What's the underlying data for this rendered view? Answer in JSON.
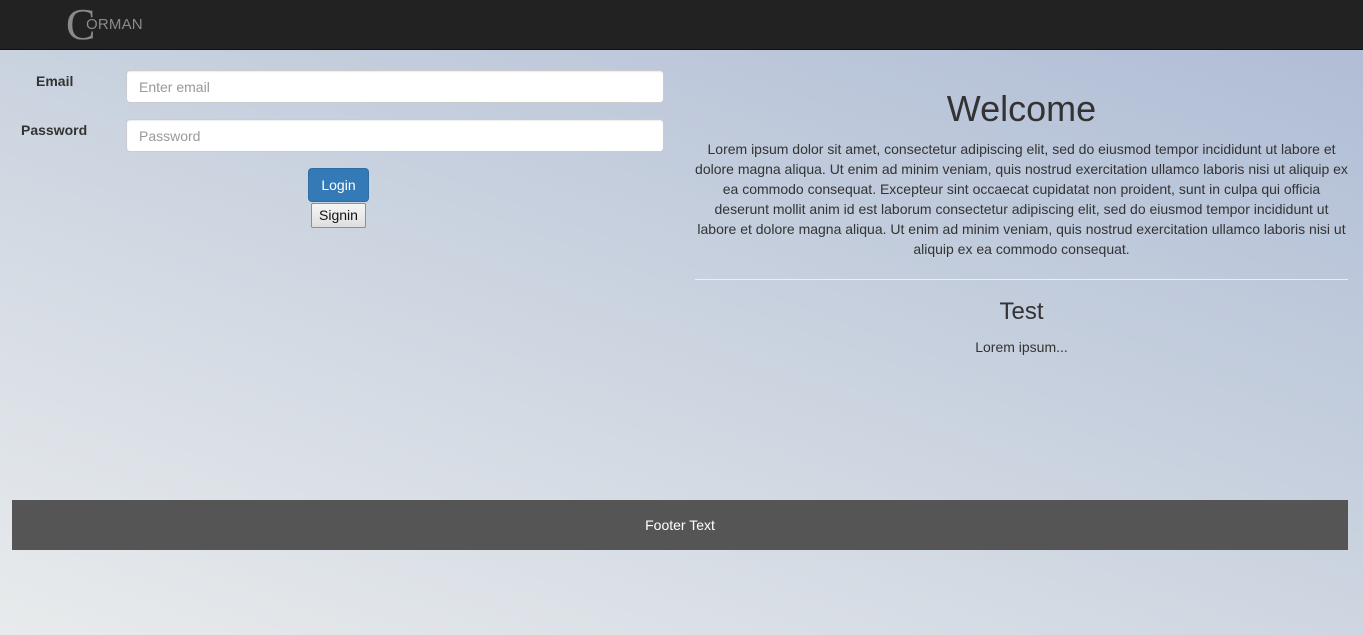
{
  "navbar": {
    "logo_initial": "C",
    "logo_rest": "ORMAN"
  },
  "login_form": {
    "email_label": "Email",
    "email_placeholder": "Enter email",
    "email_value": "",
    "password_label": "Password",
    "password_placeholder": "Password",
    "password_value": "",
    "login_button": "Login",
    "signin_button": "Signin"
  },
  "main": {
    "welcome_title": "Welcome",
    "welcome_text": "Lorem ipsum dolor sit amet, consectetur adipiscing elit, sed do eiusmod tempor incididunt ut labore et dolore magna aliqua. Ut enim ad minim veniam, quis nostrud exercitation ullamco laboris nisi ut aliquip ex ea commodo consequat. Excepteur sint occaecat cupidatat non proident, sunt in culpa qui officia deserunt mollit anim id est laborum consectetur adipiscing elit, sed do eiusmod tempor incididunt ut labore et dolore magna aliqua. Ut enim ad minim veniam, quis nostrud exercitation ullamco laboris nisi ut aliquip ex ea commodo consequat.",
    "test_title": "Test",
    "test_text": "Lorem ipsum..."
  },
  "footer": {
    "text": "Footer Text"
  },
  "colors": {
    "navbar_bg": "#222222",
    "primary_button": "#337ab7",
    "footer_bg": "#555555"
  }
}
